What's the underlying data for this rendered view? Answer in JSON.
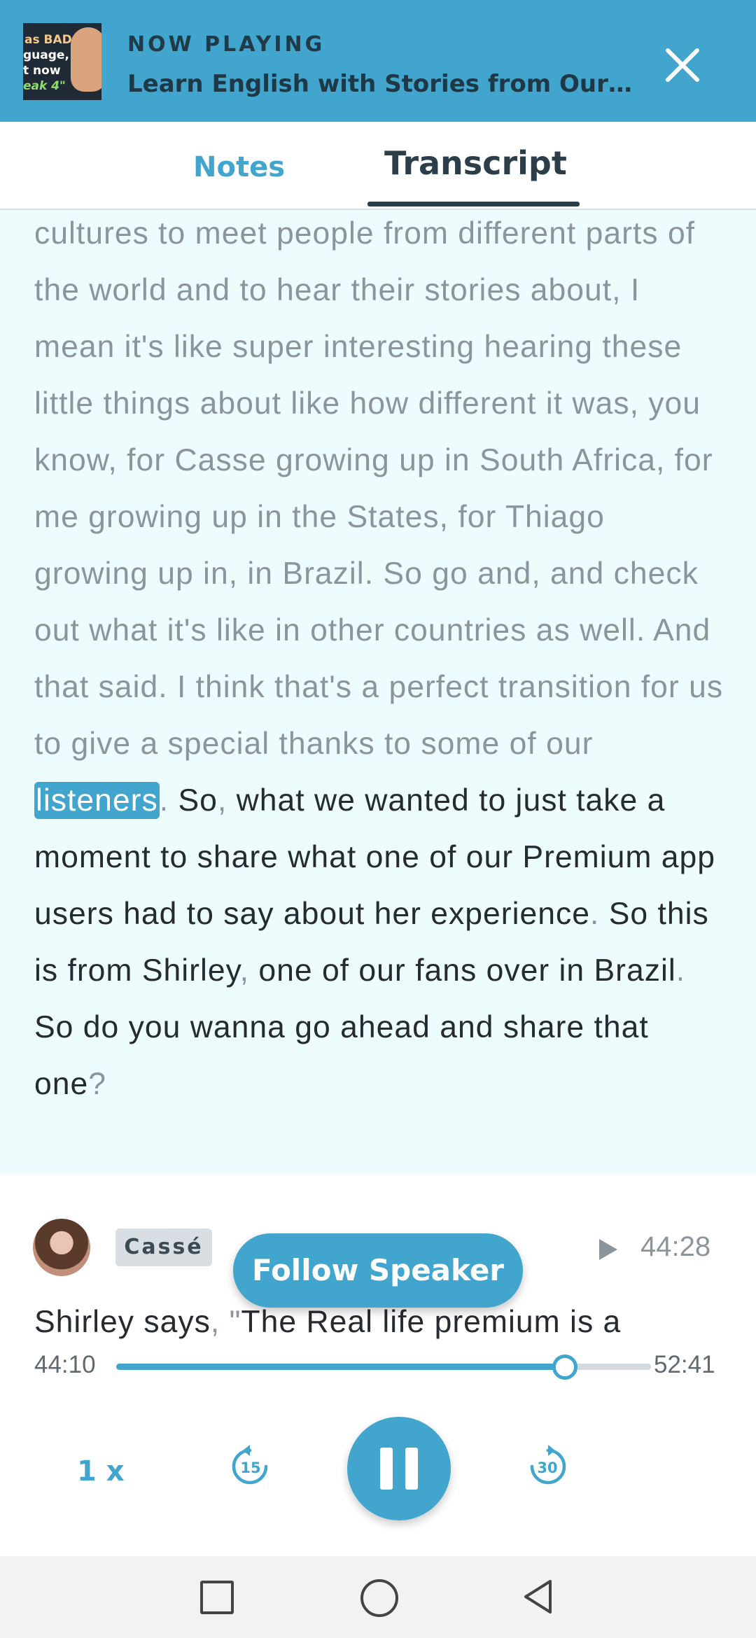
{
  "header": {
    "thumbnail_lines": [
      "as BAD at",
      "guage,",
      "t now",
      "eak 4\""
    ],
    "now_playing_label": "NOW PLAYING",
    "episode_title": "Learn English with Stories from Our ...",
    "close_icon": "close-icon"
  },
  "tabs": [
    {
      "label": "Notes",
      "active": false
    },
    {
      "label": "Transcript",
      "active": true
    }
  ],
  "transcript": {
    "played_text": "cultures to meet people from different parts of the world and to hear their stories  about, I mean it's like super interesting hearing these little things about like how different it was, you know, for Casse growing up in South Africa, for me growing up in the States, for Thiago growing up in, in Brazil. So go and, and check out  what it's like in other countries as well. And that said. I think that's a perfect transition for us to give a special thanks to some of our",
    "current_word": "listeners",
    "upcoming": [
      {
        "text": ". ",
        "dim": true
      },
      {
        "text": "So",
        "dim": false
      },
      {
        "text": ", ",
        "dim": true
      },
      {
        "text": "what we wanted to just take a moment to share what one of our Premium app users had to say about her experience",
        "dim": false
      },
      {
        "text": ". ",
        "dim": true
      },
      {
        "text": "So this is from Shirley",
        "dim": false
      },
      {
        "text": ", ",
        "dim": true
      },
      {
        "text": "one of our fans over in Brazil",
        "dim": false
      },
      {
        "text": ". ",
        "dim": true
      },
      {
        "text": "So do you wanna go ahead and share that one",
        "dim": false
      },
      {
        "text": "?",
        "dim": true
      }
    ]
  },
  "player": {
    "speaker_name": "Cassé",
    "follow_speaker_label": "Follow Speaker",
    "segment_time": "44:28",
    "current_line": [
      {
        "text": "Shirley says",
        "dim": false
      },
      {
        "text": ", ",
        "dim": true
      },
      {
        "text": "\"",
        "dim": true
      },
      {
        "text": "The Real life premium is a",
        "dim": false
      }
    ],
    "elapsed": "44:10",
    "total": "52:41",
    "progress_fraction": 0.838,
    "speed_label": "1 x",
    "skip_back_seconds": "15",
    "skip_forward_seconds": "30",
    "state": "playing"
  },
  "colors": {
    "accent": "#41a5cd",
    "transcript_bg": "#edfdfd",
    "text_dark": "#262b30",
    "text_dim": "#8b959b"
  }
}
